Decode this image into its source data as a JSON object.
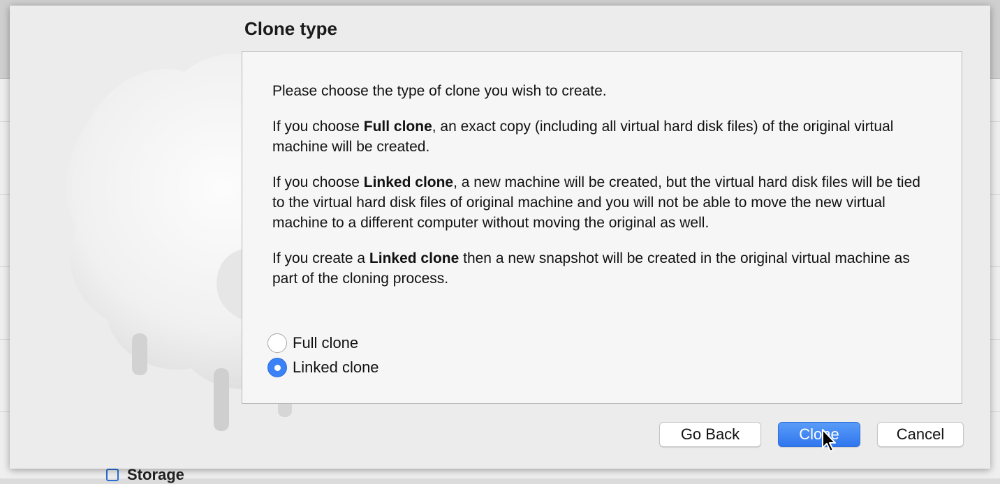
{
  "background": {
    "storage_label": "Storage"
  },
  "dialog": {
    "title": "Clone type",
    "intro": "Please choose the type of clone you wish to create.",
    "para_full": {
      "prefix": "If you choose ",
      "bold": "Full clone",
      "suffix": ", an exact copy (including all virtual hard disk files) of the original virtual machine will be created."
    },
    "para_linked": {
      "prefix": "If you choose ",
      "bold": "Linked clone",
      "suffix": ", a new machine will be created, but the virtual hard disk files will be tied to the virtual hard disk files of original machine and you will not be able to move the new virtual machine to a different computer without moving the original as well."
    },
    "para_snapshot": {
      "prefix": "If you create a ",
      "bold": "Linked clone",
      "suffix": " then a new snapshot will be created in the original virtual machine as part of the cloning process."
    },
    "options": [
      {
        "label": "Full clone",
        "selected": false
      },
      {
        "label": "Linked clone",
        "selected": true
      }
    ],
    "buttons": {
      "back": "Go Back",
      "clone": "Clone",
      "cancel": "Cancel"
    }
  },
  "colors": {
    "accent": "#3b82f6",
    "sheet_bg": "#ececec",
    "box_bg": "#f6f6f6"
  }
}
